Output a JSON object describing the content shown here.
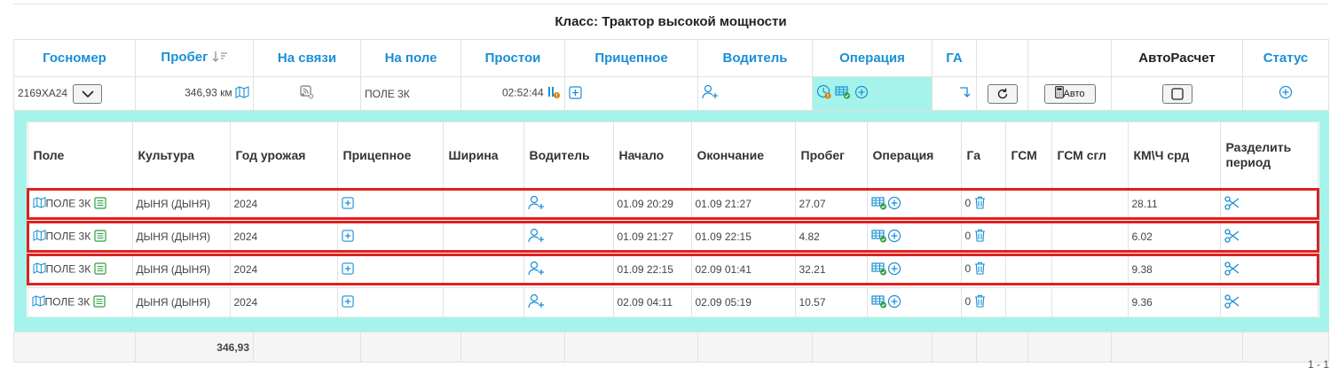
{
  "class_title": "Класс: Трактор высокой мощности",
  "header": {
    "gosnomer": "Госномер",
    "probeg": "Пробег",
    "na_svyazi": "На связи",
    "na_pole": "На поле",
    "prostoi": "Простои",
    "pricepnoe": "Прицепное",
    "voditel": "Водитель",
    "operaciya": "Операция",
    "ga": "ГА",
    "avtoraschet": "АвтоРасчет",
    "status": "Статус"
  },
  "vehicle": {
    "gosnomer": "2169ХА24",
    "probeg": "346,93 км",
    "na_pole": "ПОЛЕ 3К",
    "prostoi": "02:52:44",
    "avto_label": "Авто"
  },
  "detail_headers": {
    "pole": "Поле",
    "kultura": "Культура",
    "god": "Год урожая",
    "pricepnoe": "Прицепное",
    "shirina": "Ширина",
    "voditel": "Водитель",
    "nachalo": "Начало",
    "okonchanie": "Окончание",
    "probeg": "Пробег",
    "operaciya": "Операция",
    "ga": "Га",
    "gsm": "ГСМ",
    "gsm_sgl": "ГСМ сгл",
    "kmh": "КМ\\Ч срд",
    "razdelit_1": "Разделить",
    "razdelit_2": "период"
  },
  "rows": [
    {
      "pole": "ПОЛЕ 3К",
      "kultura": "ДЫНЯ (ДЫНЯ)",
      "god": "2024",
      "nachalo": "01.09 20:29",
      "okonchanie": "01.09 21:27",
      "probeg": "27.07",
      "ga": "0",
      "kmh": "28.11"
    },
    {
      "pole": "ПОЛЕ 3К",
      "kultura": "ДЫНЯ (ДЫНЯ)",
      "god": "2024",
      "nachalo": "01.09 21:27",
      "okonchanie": "01.09 22:15",
      "probeg": "4.82",
      "ga": "0",
      "kmh": "6.02"
    },
    {
      "pole": "ПОЛЕ 3К",
      "kultura": "ДЫНЯ (ДЫНЯ)",
      "god": "2024",
      "nachalo": "01.09 22:15",
      "okonchanie": "02.09 01:41",
      "probeg": "32.21",
      "ga": "0",
      "kmh": "9.38"
    },
    {
      "pole": "ПОЛЕ 3К",
      "kultura": "ДЫНЯ (ДЫНЯ)",
      "god": "2024",
      "nachalo": "02.09 04:11",
      "okonchanie": "02.09 05:19",
      "probeg": "10.57",
      "ga": "0",
      "kmh": "9.36"
    }
  ],
  "footer": {
    "probeg_total": "346,93"
  },
  "pager": "1 - 1",
  "colors": {
    "accent": "#1a8fd6",
    "highlight": "#e02020",
    "detail_bg": "#a5f3ea",
    "ok_green": "#2e9e3e",
    "warn_orange": "#e07a12"
  },
  "icons": [
    "sort-desc-icon",
    "map-icon",
    "no-signal-icon",
    "pause-chart-icon",
    "plus-square-icon",
    "add-user-icon",
    "clock-icon",
    "table-check-icon",
    "plus-circle-icon",
    "turn-down-arrow-icon",
    "refresh-icon",
    "calculator-icon",
    "checkbox-icon",
    "list-icon",
    "trash-icon",
    "scissors-icon",
    "chevron-down-icon"
  ]
}
